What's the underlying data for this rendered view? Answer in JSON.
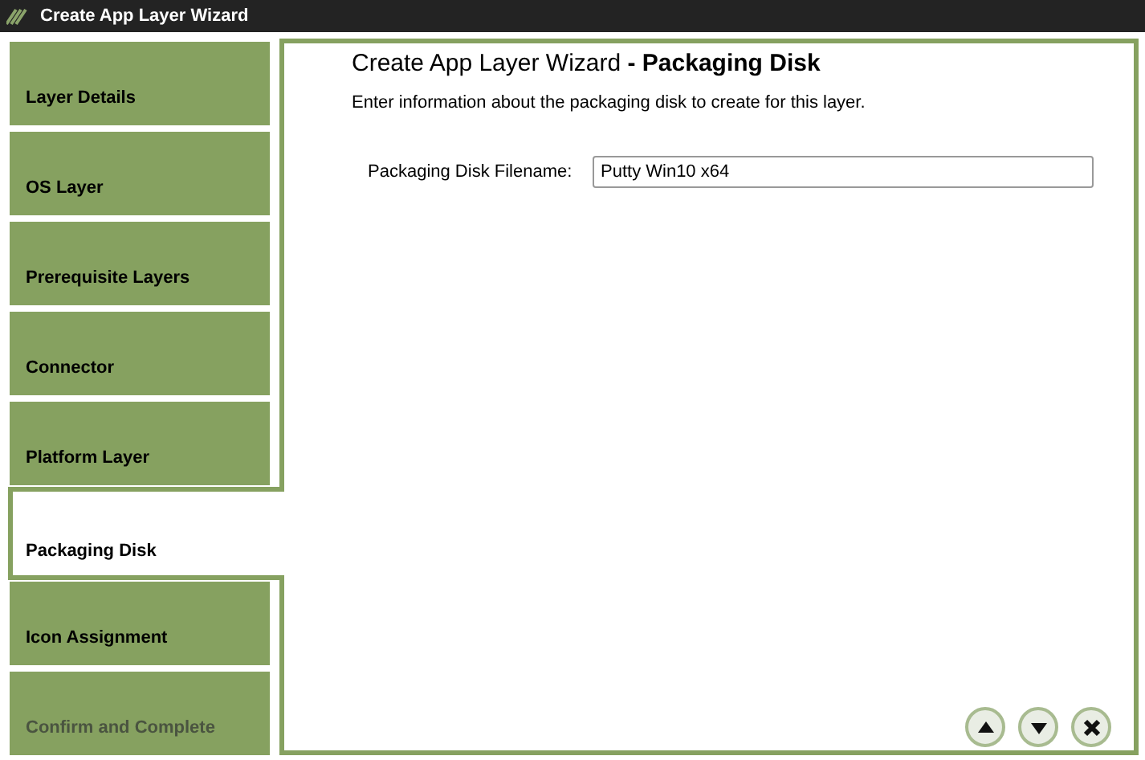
{
  "window": {
    "title": "Create App Layer Wizard"
  },
  "steps": [
    {
      "label": "Layer Details",
      "selected": false,
      "disabled": false
    },
    {
      "label": "OS Layer",
      "selected": false,
      "disabled": false
    },
    {
      "label": "Prerequisite Layers",
      "selected": false,
      "disabled": false
    },
    {
      "label": "Connector",
      "selected": false,
      "disabled": false
    },
    {
      "label": "Platform Layer",
      "selected": false,
      "disabled": false
    },
    {
      "label": "Packaging Disk",
      "selected": true,
      "disabled": false
    },
    {
      "label": "Icon Assignment",
      "selected": false,
      "disabled": false
    },
    {
      "label": "Confirm and Complete",
      "selected": false,
      "disabled": true
    }
  ],
  "panel": {
    "heading": "Create App Layer Wizard **- Packaging Disk**",
    "description": "Enter information about the packaging disk to create for this layer.",
    "field": {
      "label": "Packaging Disk Filename:",
      "value": "Putty Win10 x64"
    }
  },
  "nav_buttons": [
    {
      "kind": "up"
    },
    {
      "kind": "down"
    },
    {
      "kind": "close"
    }
  ]
}
